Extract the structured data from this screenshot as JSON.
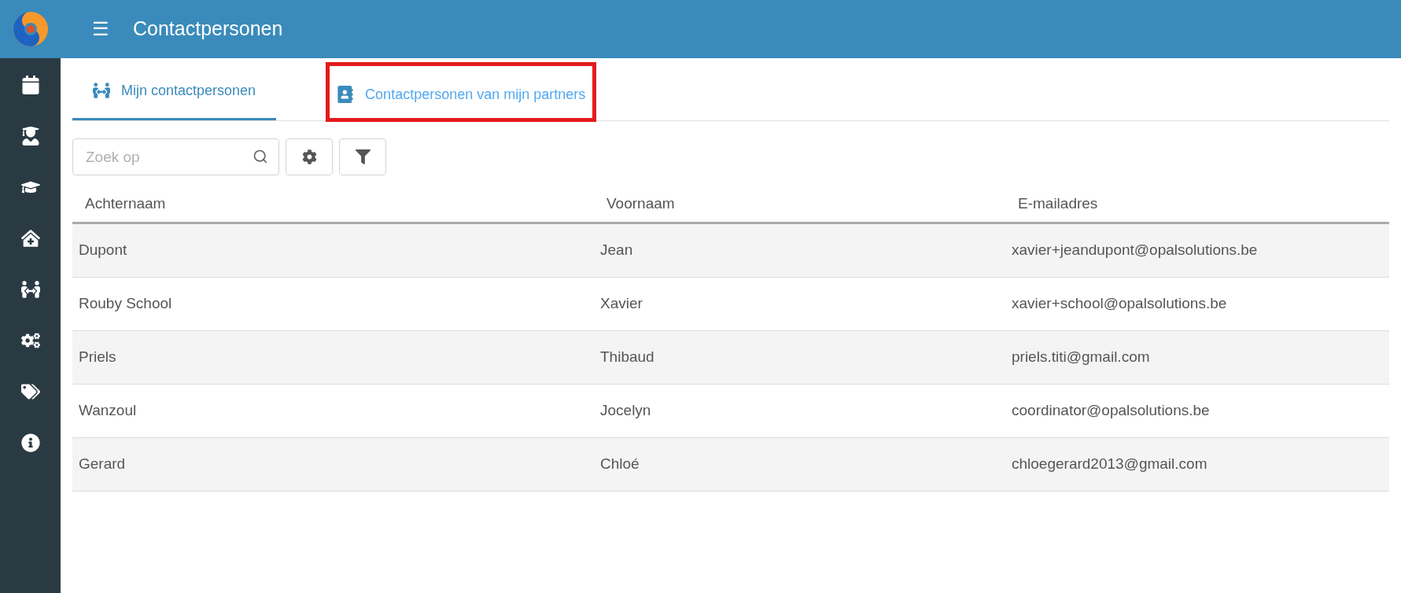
{
  "header": {
    "menu_glyph": "☰",
    "title": "Contactpersonen"
  },
  "sidebar": {
    "items": [
      {
        "kind": "calendar"
      },
      {
        "kind": "teacher"
      },
      {
        "kind": "graduation"
      },
      {
        "kind": "clinic"
      },
      {
        "kind": "people"
      },
      {
        "kind": "cogs"
      },
      {
        "kind": "tags"
      },
      {
        "kind": "info"
      }
    ]
  },
  "tabs": [
    {
      "label": "Mijn contactpersonen",
      "kind": "people",
      "selected": true,
      "highlighted": false
    },
    {
      "label": "Contactpersonen van mijn partners",
      "kind": "addressbook",
      "selected": false,
      "highlighted": true
    }
  ],
  "search": {
    "placeholder": "Zoek op"
  },
  "table": {
    "columns": [
      "Achternaam",
      "Voornaam",
      "E-mailadres"
    ],
    "rows": [
      [
        "Dupont",
        "Jean",
        "xavier+jeandupont@opalsolutions.be"
      ],
      [
        "Rouby School",
        "Xavier",
        "xavier+school@opalsolutions.be"
      ],
      [
        "Priels",
        "Thibaud",
        "priels.titi@gmail.com"
      ],
      [
        "Wanzoul",
        "Jocelyn",
        "coordinator@opalsolutions.be"
      ],
      [
        "Gerard",
        "Chloé",
        "chloegerard2013@gmail.com"
      ]
    ]
  }
}
